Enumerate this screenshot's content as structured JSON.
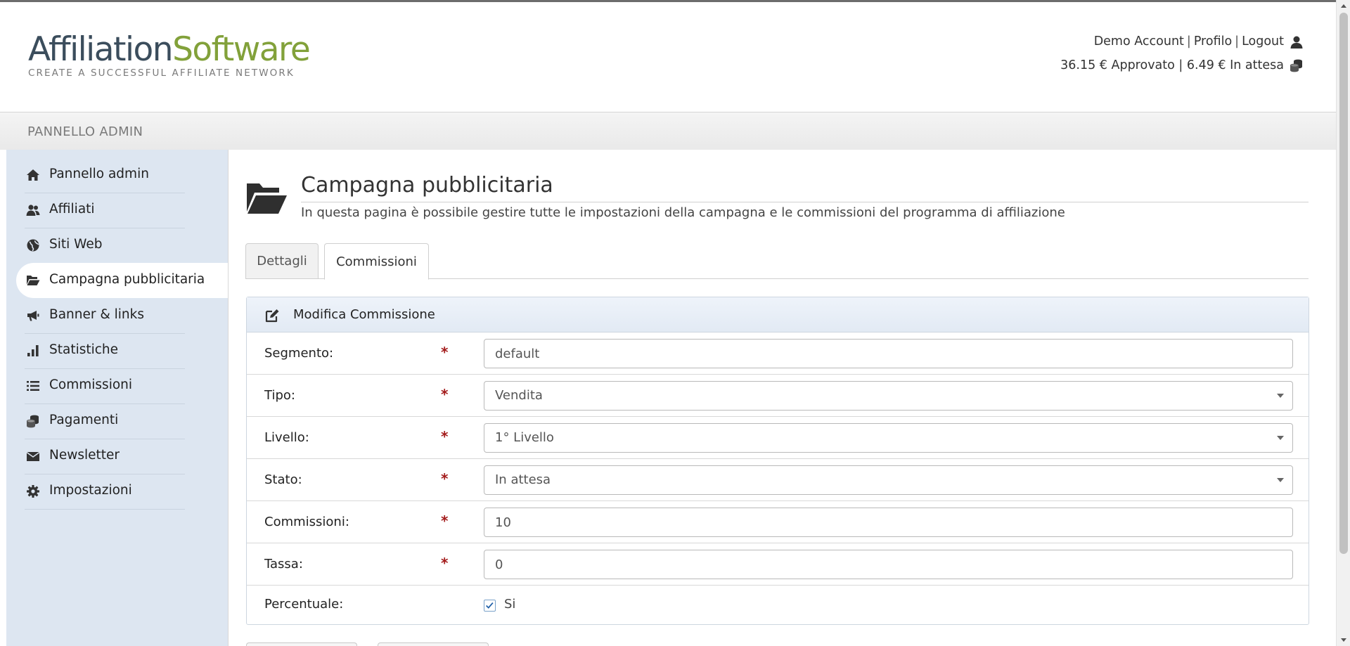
{
  "brand": {
    "logo_part1": "Affiliation",
    "logo_part2": "Software",
    "tagline": "CREATE A SUCCESSFUL AFFILIATE NETWORK",
    "color_dark": "#3b4d5c",
    "color_green": "#82a13a"
  },
  "account": {
    "name": "Demo Account",
    "profile": "Profilo",
    "logout": "Logout",
    "approved": "36.15 € Approvato",
    "pending": "6.49 € In attesa",
    "user_icon": "user-icon",
    "coins_icon": "coins-icon"
  },
  "admin_strip": {
    "title": "PANNELLO ADMIN"
  },
  "sidebar": {
    "items": [
      {
        "label": "Pannello admin",
        "icon": "home-icon"
      },
      {
        "label": "Affiliati",
        "icon": "users-icon"
      },
      {
        "label": "Siti Web",
        "icon": "globe-icon"
      },
      {
        "label": "Campagna pubblicitaria",
        "icon": "folder-open-icon",
        "active": true
      },
      {
        "label": "Banner & links",
        "icon": "bullhorn-icon"
      },
      {
        "label": "Statistiche",
        "icon": "bar-chart-icon"
      },
      {
        "label": "Commissioni",
        "icon": "list-icon"
      },
      {
        "label": "Pagamenti",
        "icon": "coins-icon"
      },
      {
        "label": "Newsletter",
        "icon": "envelope-icon"
      },
      {
        "label": "Impostazioni",
        "icon": "gear-icon"
      }
    ]
  },
  "page": {
    "title": "Campagna pubblicitaria",
    "description": "In questa pagina è possibile gestire tutte le impostazioni della campagna e le commissioni del programma di affiliazione"
  },
  "tabs": [
    {
      "label": "Dettagli",
      "active": false
    },
    {
      "label": "Commissioni",
      "active": true
    }
  ],
  "form": {
    "title": "Modifica Commissione",
    "required_mark": "*",
    "segmento": {
      "label": "Segmento:",
      "value": "default"
    },
    "tipo": {
      "label": "Tipo:",
      "value": "Vendita"
    },
    "livello": {
      "label": "Livello:",
      "value": "1° Livello"
    },
    "stato": {
      "label": "Stato:",
      "value": "In attesa"
    },
    "commissioni": {
      "label": "Commissioni:",
      "value": "10"
    },
    "tassa": {
      "label": "Tassa:",
      "value": "0"
    },
    "percentuale": {
      "label": "Percentuale:",
      "checkbox_label": "Si",
      "checked": true
    }
  }
}
